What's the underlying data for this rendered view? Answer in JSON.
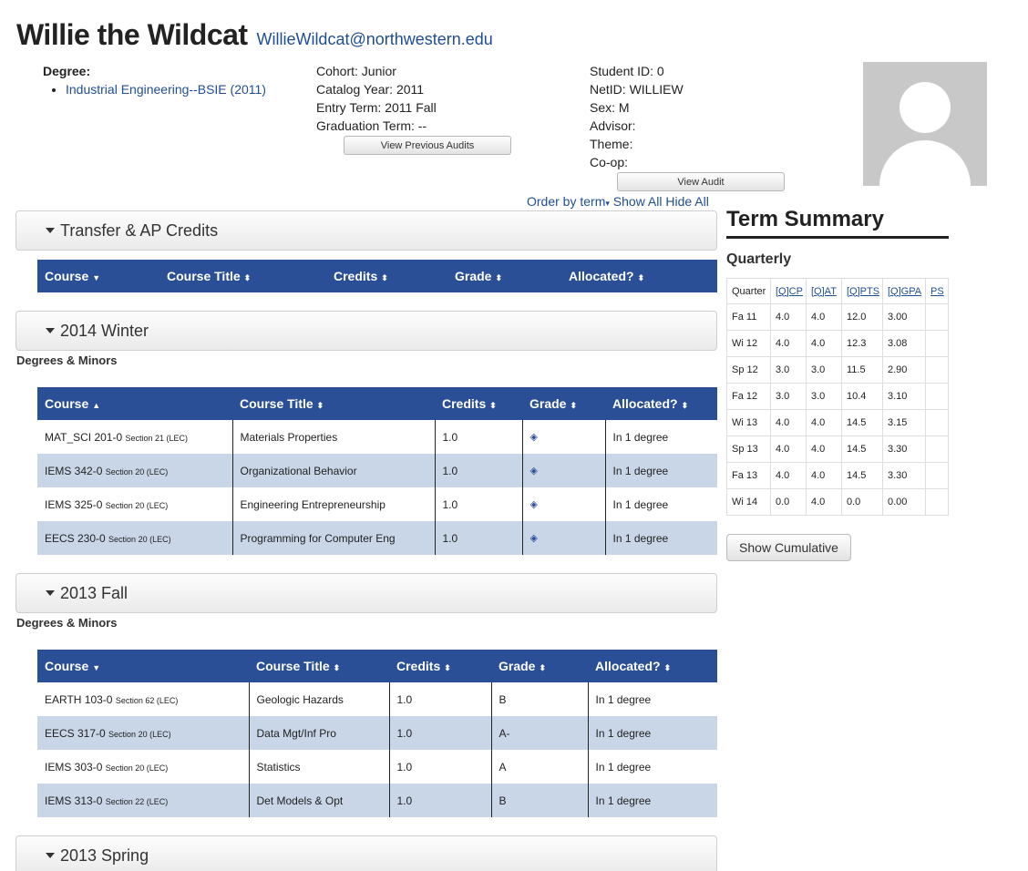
{
  "student": {
    "name": "Willie the Wildcat",
    "email": "WillieWildcat@northwestern.edu",
    "degree_label": "Degree:",
    "degree": "Industrial Engineering--BSIE (2011)",
    "cohort": "Cohort: Junior",
    "catalog_year": "Catalog Year: 2011",
    "entry_term": "Entry Term: 2011 Fall",
    "graduation_term": "Graduation Term: --",
    "student_id": "Student ID: 0",
    "netid": "NetID: WILLIEW",
    "sex": "Sex: M",
    "advisor": "Advisor:",
    "theme": "Theme:",
    "coop": "Co-op:"
  },
  "buttons": {
    "view_previous_audits": "View Previous Audits",
    "view_audit": "View Audit",
    "show_cumulative": "Show Cumulative"
  },
  "order_links": {
    "order_by_term": "Order by term",
    "show_all": "Show All",
    "hide_all": "Hide All"
  },
  "sections": {
    "transfer": {
      "title": "Transfer & AP Credits",
      "headers": [
        "Course",
        "Course Title",
        "Credits",
        "Grade",
        "Allocated?"
      ]
    },
    "winter2014": {
      "title": "2014 Winter",
      "sub": "Degrees & Minors",
      "headers": [
        "Course",
        "Course Title",
        "Credits",
        "Grade",
        "Allocated?"
      ],
      "rows": [
        {
          "course": "MAT_SCI 201-0",
          "section": "Section 21 (LEC)",
          "title": "Materials Properties",
          "credits": "1.0",
          "grade": "◈",
          "allocated": "In 1 degree"
        },
        {
          "course": "IEMS 342-0",
          "section": "Section 20 (LEC)",
          "title": "Organizational Behavior",
          "credits": "1.0",
          "grade": "◈",
          "allocated": "In 1 degree"
        },
        {
          "course": "IEMS 325-0",
          "section": "Section 20 (LEC)",
          "title": "Engineering Entrepreneurship",
          "credits": "1.0",
          "grade": "◈",
          "allocated": "In 1 degree"
        },
        {
          "course": "EECS 230-0",
          "section": "Section 20 (LEC)",
          "title": "Programming for Computer Eng",
          "credits": "1.0",
          "grade": "◈",
          "allocated": "In 1 degree"
        }
      ]
    },
    "fall2013": {
      "title": "2013 Fall",
      "sub": "Degrees & Minors",
      "headers": [
        "Course",
        "Course Title",
        "Credits",
        "Grade",
        "Allocated?"
      ],
      "rows": [
        {
          "course": "EARTH 103-0",
          "section": "Section 62 (LEC)",
          "title": "Geologic Hazards",
          "credits": "1.0",
          "grade": "B",
          "allocated": "In 1 degree"
        },
        {
          "course": "EECS 317-0",
          "section": "Section 20 (LEC)",
          "title": "Data Mgt/Inf Pro",
          "credits": "1.0",
          "grade": "A-",
          "allocated": "In 1 degree"
        },
        {
          "course": "IEMS 303-0",
          "section": "Section 20 (LEC)",
          "title": "Statistics",
          "credits": "1.0",
          "grade": "A",
          "allocated": "In 1 degree"
        },
        {
          "course": "IEMS 313-0",
          "section": "Section 22 (LEC)",
          "title": "Det Models & Opt",
          "credits": "1.0",
          "grade": "B",
          "allocated": "In 1 degree"
        }
      ]
    },
    "spring2013": {
      "title": "2013 Spring"
    }
  },
  "term_summary": {
    "title": "Term Summary",
    "sub": "Quarterly",
    "headers": [
      "Quarter",
      "[Q]CP",
      "[Q]AT",
      "[Q]PTS",
      "[Q]GPA",
      "PS"
    ],
    "rows": [
      [
        "Fa 11",
        "4.0",
        "4.0",
        "12.0",
        "3.00",
        ""
      ],
      [
        "Wi 12",
        "4.0",
        "4.0",
        "12.3",
        "3.08",
        ""
      ],
      [
        "Sp 12",
        "3.0",
        "3.0",
        "11.5",
        "2.90",
        ""
      ],
      [
        "Fa 12",
        "3.0",
        "3.0",
        "10.4",
        "3.10",
        ""
      ],
      [
        "Wi 13",
        "4.0",
        "4.0",
        "14.5",
        "3.15",
        ""
      ],
      [
        "Sp 13",
        "4.0",
        "4.0",
        "14.5",
        "3.30",
        ""
      ],
      [
        "Fa 13",
        "4.0",
        "4.0",
        "14.5",
        "3.30",
        ""
      ],
      [
        "Wi 14",
        "0.0",
        "4.0",
        "0.0",
        "0.00",
        ""
      ]
    ]
  },
  "colors": {
    "table_header": "#2a4f97",
    "row_alt": "#c8d6e8",
    "link": "#1f4e96"
  }
}
